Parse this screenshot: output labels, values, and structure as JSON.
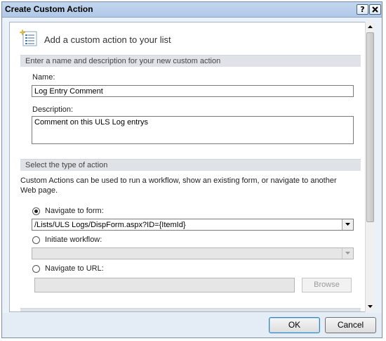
{
  "window": {
    "title": "Create Custom Action",
    "help_label": "?"
  },
  "header": {
    "text": "Add a custom action to your list",
    "icon": "list-add-icon"
  },
  "name_section": {
    "heading": "Enter a name and description for your new custom action",
    "name_label": "Name:",
    "name_value": "Log Entry Comment",
    "description_label": "Description:",
    "description_value": "Comment on this ULS Log entrys"
  },
  "action_section": {
    "heading": "Select the type of action",
    "description": "Custom Actions can be used to run a workflow, show an existing form, or navigate to another Web page.",
    "options": [
      {
        "label": "Navigate to form:",
        "selected": true
      },
      {
        "label": "Initiate workflow:",
        "selected": false
      },
      {
        "label": "Navigate to URL:",
        "selected": false
      }
    ],
    "form_value": "/Lists/ULS Logs/DispForm.aspx?ID={ItemId}",
    "workflow_value": "",
    "url_value": "",
    "browse_label": "Browse"
  },
  "buttons": {
    "ok": "OK",
    "cancel": "Cancel"
  }
}
